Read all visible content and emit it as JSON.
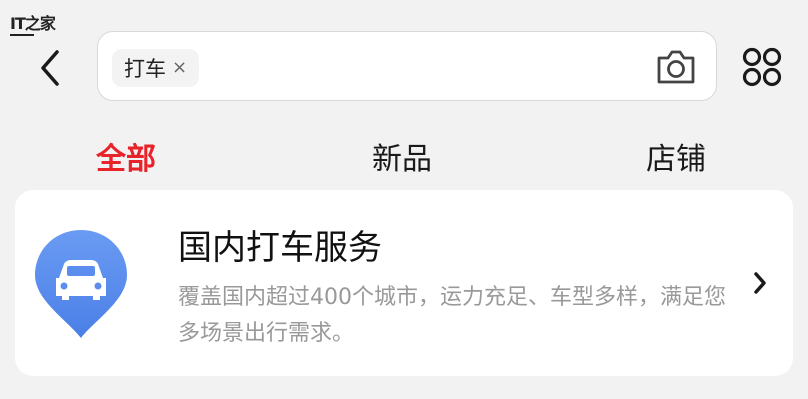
{
  "watermark": {
    "logo_text": "IT之家"
  },
  "header": {
    "back_icon": "chevron-left-icon",
    "search": {
      "tag_text": "打车",
      "tag_close": "×",
      "placeholder": ""
    },
    "camera_icon": "camera-icon",
    "menu_icon": "grid-dots-icon"
  },
  "tabs": [
    {
      "label": "全部",
      "active": true
    },
    {
      "label": "新品",
      "active": false
    },
    {
      "label": "店铺",
      "active": false
    }
  ],
  "result": {
    "title": "国内打车服务",
    "description": "覆盖国内超过400个城市，运力充足、车型多样，满足您多场景出行需求。",
    "icon": "car-pin-icon",
    "chevron": "chevron-right-icon"
  },
  "colors": {
    "accent": "#e8232a",
    "icon_blue": "#5b8def",
    "background": "#f2f2f2"
  }
}
